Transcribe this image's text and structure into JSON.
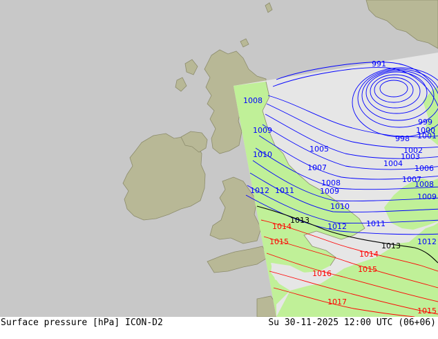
{
  "footer": {
    "title": "Surface pressure [hPa] ICON-D2",
    "valid_time": "Su 30-11-2025 12:00 UTC (06+06)"
  },
  "colors": {
    "background_sea": "#c8c8c8",
    "land_outside": "#b8b896",
    "model_domain_land": "#c0f098",
    "model_domain_sea": "#e6e6e6",
    "isobar_low": "#0000ff",
    "isobar_reference": "#000000",
    "isobar_high": "#ff0000",
    "coastline": "#8c8c6c"
  },
  "isobars": [
    {
      "value": "991",
      "color": "blue"
    },
    {
      "value": "1008",
      "color": "blue"
    },
    {
      "value": "1009",
      "color": "blue"
    },
    {
      "value": "1010",
      "color": "blue"
    },
    {
      "value": "1005",
      "color": "blue"
    },
    {
      "value": "1007",
      "color": "blue"
    },
    {
      "value": "1008",
      "color": "blue"
    },
    {
      "value": "1009",
      "color": "blue"
    },
    {
      "value": "1011",
      "color": "blue"
    },
    {
      "value": "1012",
      "color": "blue"
    },
    {
      "value": "1010",
      "color": "blue"
    },
    {
      "value": "1012",
      "color": "blue"
    },
    {
      "value": "1011",
      "color": "blue"
    },
    {
      "value": "1013",
      "color": "black"
    },
    {
      "value": "1013",
      "color": "black"
    },
    {
      "value": "1014",
      "color": "red"
    },
    {
      "value": "1015",
      "color": "red"
    },
    {
      "value": "1014",
      "color": "red"
    },
    {
      "value": "1016",
      "color": "red"
    },
    {
      "value": "1015",
      "color": "red"
    },
    {
      "value": "1017",
      "color": "red"
    },
    {
      "value": "1015",
      "color": "red"
    },
    {
      "value": "999",
      "color": "blue"
    },
    {
      "value": "998",
      "color": "blue"
    },
    {
      "value": "1000",
      "color": "blue"
    },
    {
      "value": "1001",
      "color": "blue"
    },
    {
      "value": "1002",
      "color": "blue"
    },
    {
      "value": "1003",
      "color": "blue"
    },
    {
      "value": "1004",
      "color": "blue"
    },
    {
      "value": "1006",
      "color": "blue"
    },
    {
      "value": "1007",
      "color": "blue"
    },
    {
      "value": "1008",
      "color": "blue"
    },
    {
      "value": "1009",
      "color": "blue"
    },
    {
      "value": "1012",
      "color": "blue"
    }
  ]
}
